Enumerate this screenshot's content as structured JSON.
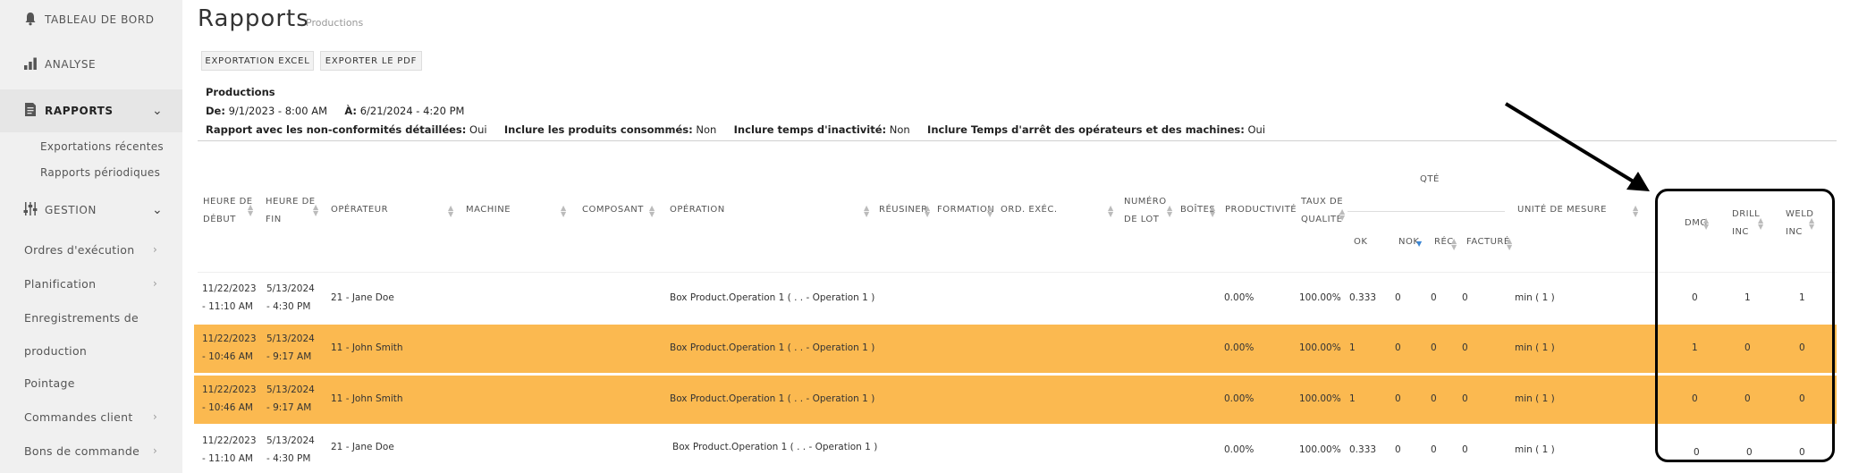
{
  "sidebar": {
    "top_items": [
      {
        "label": "TABLEAU DE BORD",
        "icon": "bell-icon"
      },
      {
        "label": "ANALYSE",
        "icon": "bar-chart-icon"
      },
      {
        "label": "RAPPORTS",
        "icon": "document-icon",
        "expanded": true
      },
      {
        "label": "GESTION",
        "icon": "sliders-icon",
        "expanded": true
      }
    ],
    "rapports_sub": [
      "Exportations récentes",
      "Rapports périodiques"
    ],
    "gestion_sub": [
      "Ordres d'exécution",
      "Planification",
      "Enregistrements de",
      "production",
      "Pointage",
      "Commandes client",
      "Bons de commande"
    ]
  },
  "header": {
    "title": "Rapports",
    "subtitle": "Productions"
  },
  "toolbar": {
    "excel_label": "EXPORTATION EXCEL",
    "pdf_label": "EXPORTER LE PDF"
  },
  "report_info": {
    "title": "Productions",
    "from_label": "De:",
    "from_value": "9/1/2023 - 8:00 AM",
    "to_label": "À:",
    "to_value": "6/21/2024 - 4:20 PM",
    "opt1_label": "Rapport avec les non-conformités détaillées:",
    "opt1_value": "Oui",
    "opt2_label": "Inclure les produits consommés:",
    "opt2_value": "Non",
    "opt3_label": "Inclure temps d'inactivité:",
    "opt3_value": "Non",
    "opt4_label": "Inclure Temps d'arrêt des opérateurs et des machines:",
    "opt4_value": "Oui"
  },
  "table": {
    "headers": {
      "start_1": "HEURE DE",
      "start_2": "DÉBUT",
      "end_1": "HEURE DE",
      "end_2": "FIN",
      "operator": "OPÉRATEUR",
      "machine": "MACHINE",
      "component": "COMPOSANT",
      "operation": "OPÉRATION",
      "reuse": "RÉUSINER",
      "training": "FORMATION",
      "exec_order": "ORD. EXÉC.",
      "lot_1": "NUMÉRO",
      "lot_2": "DE LOT",
      "boxes": "BOÎTES",
      "productivity": "PRODUCTIVITÉ",
      "quality_1": "TAUX DE",
      "quality_2": "QUALITÉ",
      "qty": "QTÉ",
      "ok": "OK",
      "nok": "NOK",
      "rec": "RÉC",
      "billed": "FACTURÉ",
      "unit": "UNITÉ DE MESURE",
      "dmg": "DMG",
      "drill_1": "DRILL",
      "drill_2": "INC",
      "weld_1": "WELD",
      "weld_2": "INC"
    },
    "rows": [
      {
        "start_date": "11/22/2023",
        "start_time": "- 11:10 AM",
        "end_date": "5/13/2024",
        "end_time": "- 4:30 PM",
        "operator": "21 - Jane Doe",
        "operation": "Box Product.Operation 1 ( . . - Operation 1 )",
        "productivity": "0.00%",
        "quality": "100.00%",
        "ok": "0.333",
        "nok": "0",
        "rec": "0",
        "billed": "0",
        "unit": "min ( 1 )",
        "dmg": "0",
        "drill": "1",
        "weld": "1",
        "highlighted": false
      },
      {
        "start_date": "11/22/2023",
        "start_time": "- 10:46 AM",
        "end_date": "5/13/2024",
        "end_time": "- 9:17 AM",
        "operator": "11 - John Smith",
        "operation": "Box Product.Operation 1 ( . . - Operation 1 )",
        "productivity": "0.00%",
        "quality": "100.00%",
        "ok": "1",
        "nok": "0",
        "rec": "0",
        "billed": "0",
        "unit": "min ( 1 )",
        "dmg": "1",
        "drill": "0",
        "weld": "0",
        "highlighted": true
      },
      {
        "start_date": "11/22/2023",
        "start_time": "- 10:46 AM",
        "end_date": "5/13/2024",
        "end_time": "- 9:17 AM",
        "operator": "11 - John Smith",
        "operation": "Box Product.Operation 1 ( . . - Operation 1 )",
        "productivity": "0.00%",
        "quality": "100.00%",
        "ok": "1",
        "nok": "0",
        "rec": "0",
        "billed": "0",
        "unit": "min ( 1 )",
        "dmg": "0",
        "drill": "0",
        "weld": "0",
        "highlighted": true
      },
      {
        "start_date": "11/22/2023",
        "start_time": "- 11:10 AM",
        "end_date": "5/13/2024",
        "end_time": "- 4:30 PM",
        "operator": "21 - Jane Doe",
        "operation": "Box Product.Operation 1 ( . . - Operation 1 )",
        "productivity": "0.00%",
        "quality": "100.00%",
        "ok": "0.333",
        "nok": "0",
        "rec": "0",
        "billed": "0",
        "unit": "min ( 1 )",
        "dmg": "0",
        "drill": "0",
        "weld": "0",
        "highlighted": false
      }
    ]
  },
  "colors": {
    "highlight": "#fbb950",
    "sidebar_bg": "#f0f0f0",
    "annotation": "#000000"
  }
}
